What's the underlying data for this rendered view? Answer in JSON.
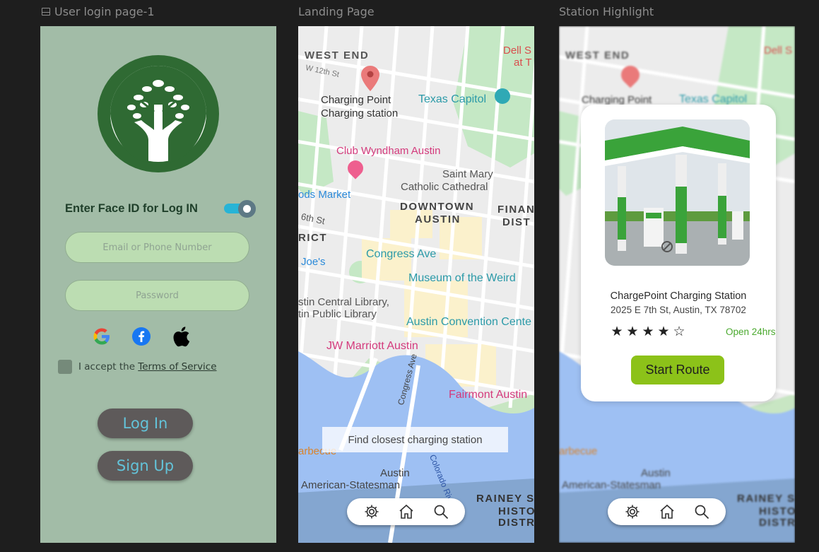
{
  "frames": {
    "login": "User login page-1",
    "landing": "Landing Page",
    "station": "Station Highlight"
  },
  "login": {
    "face_id_label": "Enter Face ID for  Log IN",
    "face_id_enabled": true,
    "email_placeholder": "Email or Phone Number",
    "password_placeholder": "Password",
    "social": [
      "google-icon",
      "facebook-icon",
      "apple-icon"
    ],
    "terms_prefix": "I accept the ",
    "terms_link": "Terms of Service",
    "login_button": "Log In",
    "signup_button": "Sign Up"
  },
  "map": {
    "west_end": "WEST END",
    "w12th": "W 12th St",
    "dell": "Dell S",
    "dell2": "at T",
    "charging_point": "Charging Point",
    "charging_station": "Charging station",
    "texas_capitol": "Texas Capitol",
    "club_wyndham": "Club Wyndham Austin",
    "saint_mary": "Saint Mary",
    "catholic": "Catholic Cathedral",
    "foods_market": "ods Market",
    "downtown": "DOWNTOWN",
    "austin": "AUSTIN",
    "finan": "FINAN",
    "dist": "DIST",
    "sixth": "6th St",
    "rict": "RICT",
    "congress": "Congress Ave",
    "joes": "Joe's",
    "museum": "Museum of the Weird",
    "central_library": "stin Central Library,",
    "public_library": "tin Public Library",
    "convention": "Austin Convention Cente",
    "jw": "JW Marriott Austin",
    "fairmont": "Fairmont Austin",
    "congress_ave": "Congress Ave",
    "barbecue": "arbecue",
    "austin_small": "Austin",
    "statesman": "American-Statesman",
    "colorado": "Colorado River",
    "rainey": "RAINEY S",
    "histo": "HISTO",
    "distr": "DISTR",
    "find_closest": "Find closest charging station"
  },
  "nav": [
    "gear-icon",
    "home-icon",
    "search-icon"
  ],
  "station": {
    "name": "ChargePoint Charging Station",
    "address": "2025 E 7th St, Austin, TX 78702",
    "rating": 4,
    "rating_max": 5,
    "hours": "Open 24hrs",
    "route_button": "Start Route"
  },
  "colors": {
    "login_bg": "#a2bca7",
    "logo_green": "#2f6a33",
    "toggle_on": "#27b4d6",
    "accent_green": "#8cc219",
    "open_green": "#4aa92e"
  }
}
